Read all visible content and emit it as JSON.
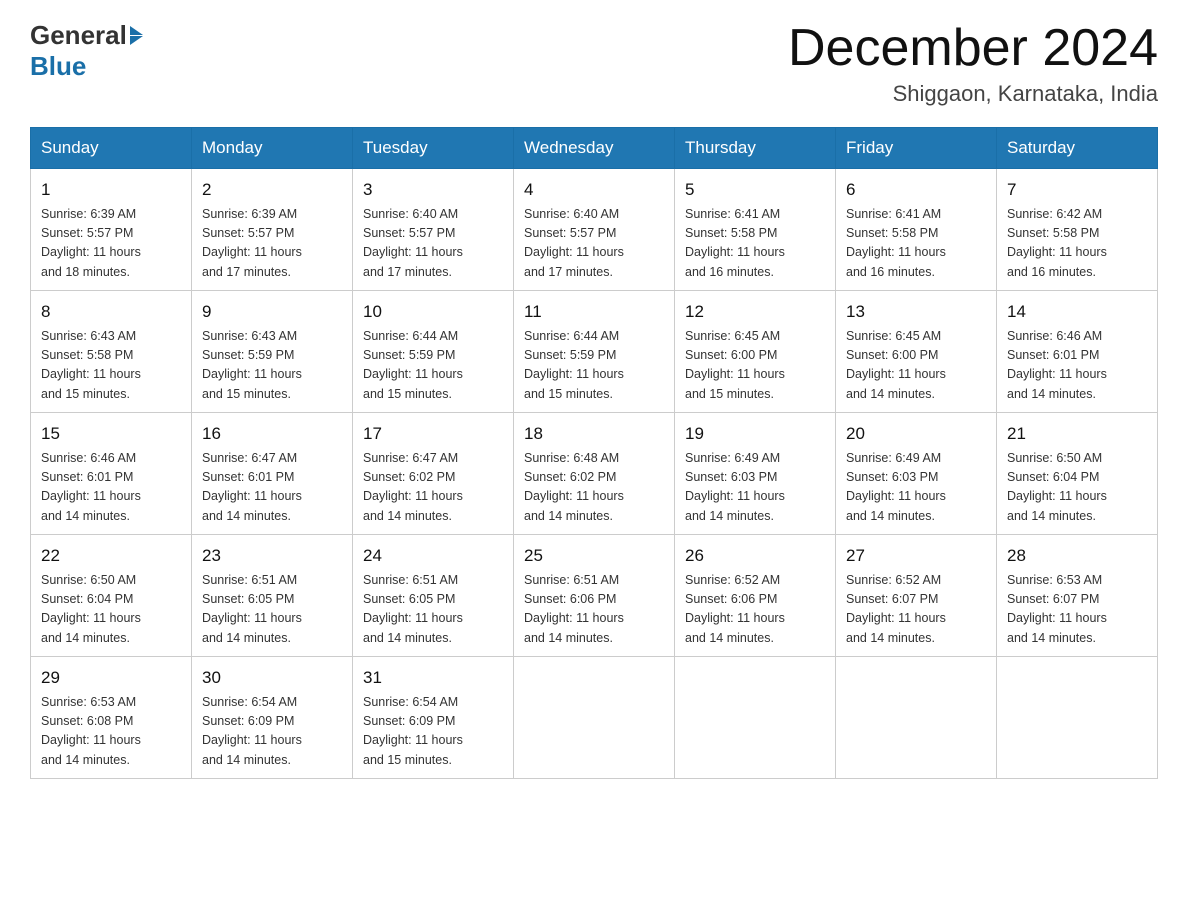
{
  "logo": {
    "general": "General",
    "arrow": "▶",
    "blue": "Blue"
  },
  "header": {
    "title": "December 2024",
    "location": "Shiggaon, Karnataka, India"
  },
  "days_of_week": [
    "Sunday",
    "Monday",
    "Tuesday",
    "Wednesday",
    "Thursday",
    "Friday",
    "Saturday"
  ],
  "weeks": [
    [
      {
        "day": "1",
        "info": "Sunrise: 6:39 AM\nSunset: 5:57 PM\nDaylight: 11 hours\nand 18 minutes."
      },
      {
        "day": "2",
        "info": "Sunrise: 6:39 AM\nSunset: 5:57 PM\nDaylight: 11 hours\nand 17 minutes."
      },
      {
        "day": "3",
        "info": "Sunrise: 6:40 AM\nSunset: 5:57 PM\nDaylight: 11 hours\nand 17 minutes."
      },
      {
        "day": "4",
        "info": "Sunrise: 6:40 AM\nSunset: 5:57 PM\nDaylight: 11 hours\nand 17 minutes."
      },
      {
        "day": "5",
        "info": "Sunrise: 6:41 AM\nSunset: 5:58 PM\nDaylight: 11 hours\nand 16 minutes."
      },
      {
        "day": "6",
        "info": "Sunrise: 6:41 AM\nSunset: 5:58 PM\nDaylight: 11 hours\nand 16 minutes."
      },
      {
        "day": "7",
        "info": "Sunrise: 6:42 AM\nSunset: 5:58 PM\nDaylight: 11 hours\nand 16 minutes."
      }
    ],
    [
      {
        "day": "8",
        "info": "Sunrise: 6:43 AM\nSunset: 5:58 PM\nDaylight: 11 hours\nand 15 minutes."
      },
      {
        "day": "9",
        "info": "Sunrise: 6:43 AM\nSunset: 5:59 PM\nDaylight: 11 hours\nand 15 minutes."
      },
      {
        "day": "10",
        "info": "Sunrise: 6:44 AM\nSunset: 5:59 PM\nDaylight: 11 hours\nand 15 minutes."
      },
      {
        "day": "11",
        "info": "Sunrise: 6:44 AM\nSunset: 5:59 PM\nDaylight: 11 hours\nand 15 minutes."
      },
      {
        "day": "12",
        "info": "Sunrise: 6:45 AM\nSunset: 6:00 PM\nDaylight: 11 hours\nand 15 minutes."
      },
      {
        "day": "13",
        "info": "Sunrise: 6:45 AM\nSunset: 6:00 PM\nDaylight: 11 hours\nand 14 minutes."
      },
      {
        "day": "14",
        "info": "Sunrise: 6:46 AM\nSunset: 6:01 PM\nDaylight: 11 hours\nand 14 minutes."
      }
    ],
    [
      {
        "day": "15",
        "info": "Sunrise: 6:46 AM\nSunset: 6:01 PM\nDaylight: 11 hours\nand 14 minutes."
      },
      {
        "day": "16",
        "info": "Sunrise: 6:47 AM\nSunset: 6:01 PM\nDaylight: 11 hours\nand 14 minutes."
      },
      {
        "day": "17",
        "info": "Sunrise: 6:47 AM\nSunset: 6:02 PM\nDaylight: 11 hours\nand 14 minutes."
      },
      {
        "day": "18",
        "info": "Sunrise: 6:48 AM\nSunset: 6:02 PM\nDaylight: 11 hours\nand 14 minutes."
      },
      {
        "day": "19",
        "info": "Sunrise: 6:49 AM\nSunset: 6:03 PM\nDaylight: 11 hours\nand 14 minutes."
      },
      {
        "day": "20",
        "info": "Sunrise: 6:49 AM\nSunset: 6:03 PM\nDaylight: 11 hours\nand 14 minutes."
      },
      {
        "day": "21",
        "info": "Sunrise: 6:50 AM\nSunset: 6:04 PM\nDaylight: 11 hours\nand 14 minutes."
      }
    ],
    [
      {
        "day": "22",
        "info": "Sunrise: 6:50 AM\nSunset: 6:04 PM\nDaylight: 11 hours\nand 14 minutes."
      },
      {
        "day": "23",
        "info": "Sunrise: 6:51 AM\nSunset: 6:05 PM\nDaylight: 11 hours\nand 14 minutes."
      },
      {
        "day": "24",
        "info": "Sunrise: 6:51 AM\nSunset: 6:05 PM\nDaylight: 11 hours\nand 14 minutes."
      },
      {
        "day": "25",
        "info": "Sunrise: 6:51 AM\nSunset: 6:06 PM\nDaylight: 11 hours\nand 14 minutes."
      },
      {
        "day": "26",
        "info": "Sunrise: 6:52 AM\nSunset: 6:06 PM\nDaylight: 11 hours\nand 14 minutes."
      },
      {
        "day": "27",
        "info": "Sunrise: 6:52 AM\nSunset: 6:07 PM\nDaylight: 11 hours\nand 14 minutes."
      },
      {
        "day": "28",
        "info": "Sunrise: 6:53 AM\nSunset: 6:07 PM\nDaylight: 11 hours\nand 14 minutes."
      }
    ],
    [
      {
        "day": "29",
        "info": "Sunrise: 6:53 AM\nSunset: 6:08 PM\nDaylight: 11 hours\nand 14 minutes."
      },
      {
        "day": "30",
        "info": "Sunrise: 6:54 AM\nSunset: 6:09 PM\nDaylight: 11 hours\nand 14 minutes."
      },
      {
        "day": "31",
        "info": "Sunrise: 6:54 AM\nSunset: 6:09 PM\nDaylight: 11 hours\nand 15 minutes."
      },
      null,
      null,
      null,
      null
    ]
  ]
}
